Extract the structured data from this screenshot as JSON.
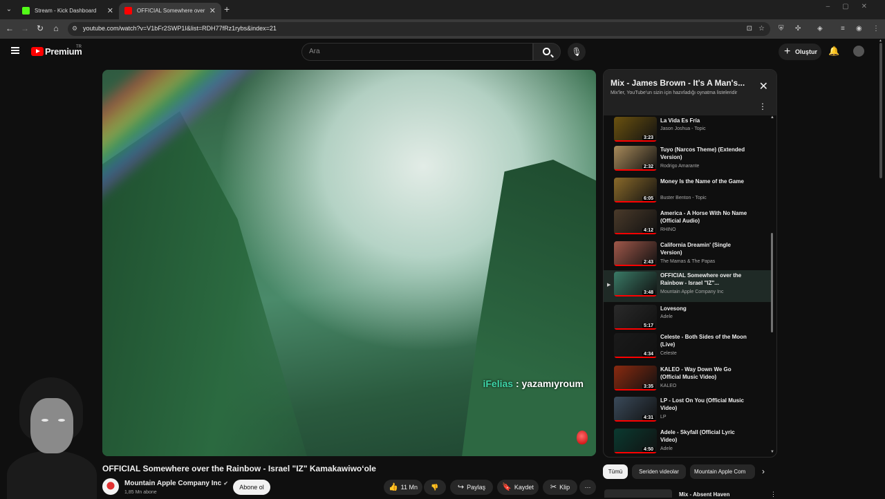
{
  "browser": {
    "tabs": [
      {
        "label": "Stream - Kick Dashboard",
        "favicon_color": "#53fc18"
      },
      {
        "label": "OFFICIAL Somewhere over",
        "favicon_color": "#ff0000"
      }
    ],
    "url": "youtube.com/watch?v=V1bFr2SWP1I&list=RDH77fRz1rybs&index=21"
  },
  "yt": {
    "logo_text": "Premium",
    "logo_region": "TR",
    "search_placeholder": "Ara",
    "create_label": "Oluştur"
  },
  "player": {
    "caption_user": "iFelias",
    "caption_text": " : yazamıyroum"
  },
  "video": {
    "title": "OFFICIAL Somewhere over the Rainbow - Israel \"IZ\" Kamakawiwoʻole",
    "channel": "Mountain Apple Company Inc",
    "subscribers": "1,85 Mn abone",
    "subscribe_label": "Abone ol",
    "likes": "11 Mn",
    "share_label": "Paylaş",
    "save_label": "Kaydet",
    "clip_label": "Klip"
  },
  "playlist": {
    "title": "Mix - James Brown - It's A Man's...",
    "subtitle": "Mix'ler, YouTube'un sizin için hazırladığı oynatma listeleridir",
    "items": [
      {
        "title": "La Vida Es Fría",
        "channel": "Jason Joshua - Topic",
        "duration": "3:23",
        "thumb": "#6b5210"
      },
      {
        "title": "Tuyo (Narcos Theme) (Extended Version)",
        "channel": "Rodrigo Amarante",
        "duration": "2:32",
        "thumb": "#a88a5a"
      },
      {
        "title": "Money Is the Name of the Game",
        "channel": "Buster Benton - Topic",
        "duration": "6:05",
        "thumb": "#8a6a2a"
      },
      {
        "title": "America - A Horse With No Name (Official Audio)",
        "channel": "RHINO",
        "duration": "4:12",
        "thumb": "#4a3a2a"
      },
      {
        "title": "California Dreamin' (Single Version)",
        "channel": "The Mamas & The Papas",
        "duration": "2:43",
        "thumb": "#a0584a"
      },
      {
        "title": "OFFICIAL Somewhere over the Rainbow - Israel \"IZ\"...",
        "channel": "Mountain Apple Company Inc",
        "duration": "3:48",
        "thumb": "#3a7a66",
        "active": true
      },
      {
        "title": "Lovesong",
        "channel": "Adele",
        "duration": "5:17",
        "thumb": "#2a2a2a"
      },
      {
        "title": "Celeste - Both Sides of the Moon (Live)",
        "channel": "Celeste",
        "duration": "4:34",
        "thumb": "#1a1a1a"
      },
      {
        "title": "KALEO - Way Down We Go (Official Music Video)",
        "channel": "KALEO",
        "duration": "3:35",
        "thumb": "#8a2a10"
      },
      {
        "title": "LP - Lost On You (Official Music Video)",
        "channel": "LP",
        "duration": "4:31",
        "thumb": "#3a4a5a"
      },
      {
        "title": "Adele - Skyfall (Official Lyric Video)",
        "channel": "Adele",
        "duration": "4:50",
        "thumb": "#0a3a30"
      }
    ]
  },
  "chips": [
    "Tümü",
    "Seriden videolar",
    "Mountain Apple Com"
  ],
  "next_up": "Mix - Absent Haven"
}
